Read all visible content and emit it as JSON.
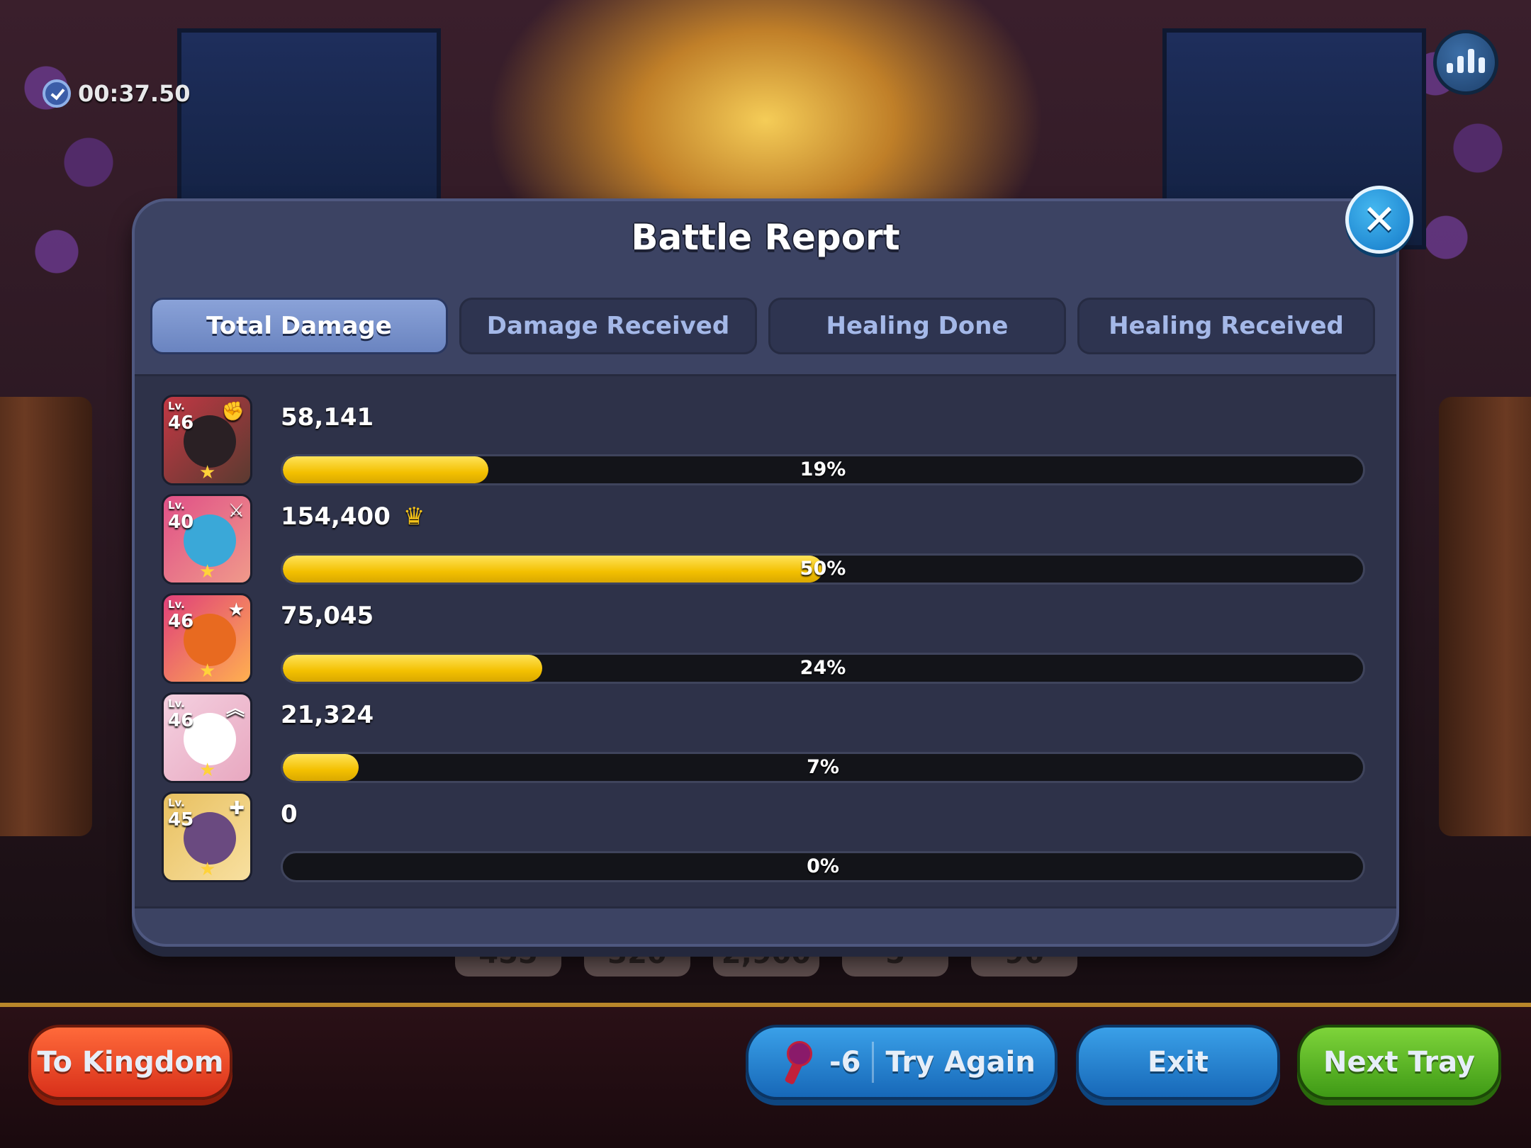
{
  "hud": {
    "timer": "00:37.50",
    "stats_icon": "bar-chart-icon"
  },
  "background_chips": [
    "455",
    "320",
    "2,900",
    "5",
    "96"
  ],
  "modal": {
    "title": "Battle Report",
    "close_icon": "close-icon",
    "tabs": [
      {
        "label": "Total Damage",
        "active": true
      },
      {
        "label": "Damage Received",
        "active": false
      },
      {
        "label": "Healing Done",
        "active": false
      },
      {
        "label": "Healing Received",
        "active": false
      }
    ],
    "rows": [
      {
        "lv_label": "Lv.",
        "level": "46",
        "value": "58,141",
        "percent_label": "19%",
        "fill": 0.19,
        "top": false,
        "class_icon": "fist-icon",
        "colors": [
          "#c23844",
          "#2a2024",
          "#5a3a30"
        ]
      },
      {
        "lv_label": "Lv.",
        "level": "40",
        "value": "154,400",
        "percent_label": "50%",
        "fill": 0.5,
        "top": true,
        "class_icon": "swords-icon",
        "colors": [
          "#e05088",
          "#3aa8d8",
          "#f09a8a"
        ]
      },
      {
        "lv_label": "Lv.",
        "level": "46",
        "value": "75,045",
        "percent_label": "24%",
        "fill": 0.24,
        "top": false,
        "class_icon": "star-icon",
        "colors": [
          "#e0407a",
          "#e86a20",
          "#ffb050"
        ]
      },
      {
        "lv_label": "Lv.",
        "level": "46",
        "value": "21,324",
        "percent_label": "7%",
        "fill": 0.07,
        "top": false,
        "class_icon": "chevron-up-icon",
        "colors": [
          "#f4d0e0",
          "#ffffff",
          "#e8a8c0"
        ]
      },
      {
        "lv_label": "Lv.",
        "level": "45",
        "value": "0",
        "percent_label": "0%",
        "fill": 0.0,
        "top": false,
        "class_icon": "plus-icon",
        "colors": [
          "#e8c060",
          "#6a4a80",
          "#f8e0a0"
        ]
      }
    ]
  },
  "buttons": {
    "to_kingdom": "To Kingdom",
    "retry_cost": "-6",
    "try_again": "Try Again",
    "exit": "Exit",
    "next_tray": "Next Tray"
  }
}
